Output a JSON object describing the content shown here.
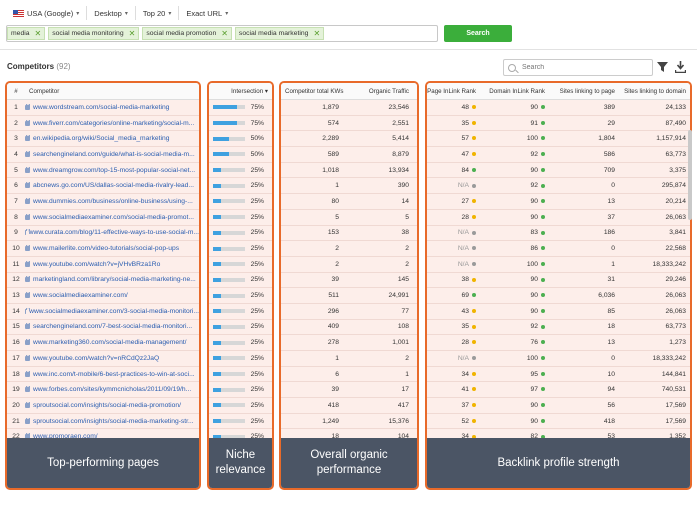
{
  "filters": {
    "country": "USA (Google)",
    "device": "Desktop",
    "top": "Top 20",
    "match": "Exact URL"
  },
  "keywords": [
    "media",
    "social media monitoring",
    "social media promotion",
    "social media marketing"
  ],
  "search_button": "Search",
  "competitors": {
    "title": "Competitors",
    "count": "(92)"
  },
  "table_search_placeholder": "Search",
  "headers": {
    "num": "#",
    "competitor": "Competitor",
    "intersection": "Intersection",
    "total_kws": "Competitor total KWs",
    "organic_traffic": "Organic Traffic",
    "page_inlink": "Page InLink Rank",
    "domain_inlink": "Domain InLink Rank",
    "sites_page": "Sites linking to page",
    "sites_domain": "Sites linking to domain"
  },
  "colors": {
    "accent": "#e86a2a",
    "green": "#3bae3b",
    "bar": "#3fa1e0",
    "dot_green": "#4caf50",
    "dot_yellow": "#f0b400",
    "dot_grey": "#9a9a9a"
  },
  "rows": [
    {
      "n": "1",
      "url": "www.wordstream.com/social-media-marketing",
      "pct": "75%",
      "fill": 0.75,
      "kws": "1,879",
      "traffic": "23,546",
      "pir": "48",
      "pird": "yellow",
      "dir": "90",
      "dird": "green",
      "slp": "389",
      "sld": "24,133"
    },
    {
      "n": "2",
      "url": "www.fiverr.com/categories/online-marketing/social-m...",
      "pct": "75%",
      "fill": 0.75,
      "kws": "574",
      "traffic": "2,551",
      "pir": "35",
      "pird": "yellow",
      "dir": "91",
      "dird": "green",
      "slp": "29",
      "sld": "87,490"
    },
    {
      "n": "3",
      "url": "en.wikipedia.org/wiki/Social_media_marketing",
      "pct": "50%",
      "fill": 0.5,
      "kws": "2,289",
      "traffic": "5,414",
      "pir": "57",
      "pird": "yellow",
      "dir": "100",
      "dird": "green",
      "slp": "1,804",
      "sld": "1,157,914"
    },
    {
      "n": "4",
      "url": "searchengineland.com/guide/what-is-social-media-m...",
      "pct": "50%",
      "fill": 0.5,
      "kws": "589",
      "traffic": "8,879",
      "pir": "47",
      "pird": "yellow",
      "dir": "92",
      "dird": "green",
      "slp": "586",
      "sld": "63,773"
    },
    {
      "n": "5",
      "url": "www.dreamgrow.com/top-15-most-popular-social-net...",
      "pct": "25%",
      "fill": 0.25,
      "kws": "1,018",
      "traffic": "13,934",
      "pir": "84",
      "pird": "green",
      "dir": "90",
      "dird": "green",
      "slp": "709",
      "sld": "3,375"
    },
    {
      "n": "6",
      "url": "abcnews.go.com/US/dallas-social-media-rivalry-lead...",
      "pct": "25%",
      "fill": 0.25,
      "kws": "1",
      "traffic": "390",
      "pir": "N/A",
      "pird": "grey",
      "dir": "92",
      "dird": "green",
      "slp": "0",
      "sld": "295,874"
    },
    {
      "n": "7",
      "url": "www.dummies.com/business/online-business/using-...",
      "pct": "25%",
      "fill": 0.25,
      "kws": "80",
      "traffic": "14",
      "pir": "27",
      "pird": "yellow",
      "dir": "90",
      "dird": "green",
      "slp": "13",
      "sld": "20,214"
    },
    {
      "n": "8",
      "url": "www.socialmediaexaminer.com/social-media-promot...",
      "pct": "25%",
      "fill": 0.25,
      "kws": "5",
      "traffic": "5",
      "pir": "28",
      "pird": "yellow",
      "dir": "90",
      "dird": "green",
      "slp": "37",
      "sld": "26,063"
    },
    {
      "n": "9",
      "url": "www.curata.com/blog/11-effective-ways-to-use-social-m...",
      "pct": "25%",
      "fill": 0.25,
      "kws": "153",
      "traffic": "38",
      "pir": "N/A",
      "pird": "grey",
      "dir": "83",
      "dird": "green",
      "slp": "186",
      "sld": "3,841"
    },
    {
      "n": "10",
      "url": "www.mailerlite.com/video-tutorials/social-pop-ups",
      "pct": "25%",
      "fill": 0.25,
      "kws": "2",
      "traffic": "2",
      "pir": "N/A",
      "pird": "grey",
      "dir": "86",
      "dird": "green",
      "slp": "0",
      "sld": "22,568"
    },
    {
      "n": "11",
      "url": "www.youtube.com/watch?v=jVHvBRza1Ro",
      "pct": "25%",
      "fill": 0.25,
      "kws": "2",
      "traffic": "2",
      "pir": "N/A",
      "pird": "grey",
      "dir": "100",
      "dird": "green",
      "slp": "1",
      "sld": "18,333,242"
    },
    {
      "n": "12",
      "url": "marketingland.com/library/social-media-marketing-ne...",
      "pct": "25%",
      "fill": 0.25,
      "kws": "39",
      "traffic": "145",
      "pir": "38",
      "pird": "yellow",
      "dir": "90",
      "dird": "green",
      "slp": "31",
      "sld": "29,246"
    },
    {
      "n": "13",
      "url": "www.socialmediaexaminer.com/",
      "pct": "25%",
      "fill": 0.25,
      "kws": "511",
      "traffic": "24,991",
      "pir": "69",
      "pird": "green",
      "dir": "90",
      "dird": "green",
      "slp": "6,036",
      "sld": "26,063"
    },
    {
      "n": "14",
      "url": "www.socialmediaexaminer.com/3-social-media-monitori...",
      "pct": "25%",
      "fill": 0.25,
      "kws": "296",
      "traffic": "77",
      "pir": "43",
      "pird": "yellow",
      "dir": "90",
      "dird": "green",
      "slp": "85",
      "sld": "26,063"
    },
    {
      "n": "15",
      "url": "searchengineland.com/7-best-social-media-monitori...",
      "pct": "25%",
      "fill": 0.25,
      "kws": "409",
      "traffic": "108",
      "pir": "35",
      "pird": "yellow",
      "dir": "92",
      "dird": "green",
      "slp": "18",
      "sld": "63,773"
    },
    {
      "n": "16",
      "url": "www.marketing360.com/social-media-management/",
      "pct": "25%",
      "fill": 0.25,
      "kws": "278",
      "traffic": "1,001",
      "pir": "28",
      "pird": "yellow",
      "dir": "76",
      "dird": "green",
      "slp": "13",
      "sld": "1,273"
    },
    {
      "n": "17",
      "url": "www.youtube.com/watch?v=nRCdQz2JaQ",
      "pct": "25%",
      "fill": 0.25,
      "kws": "1",
      "traffic": "2",
      "pir": "N/A",
      "pird": "grey",
      "dir": "100",
      "dird": "green",
      "slp": "0",
      "sld": "18,333,242"
    },
    {
      "n": "18",
      "url": "www.inc.com/t-mobile/6-best-practices-to-win-at-soci...",
      "pct": "25%",
      "fill": 0.25,
      "kws": "6",
      "traffic": "1",
      "pir": "34",
      "pird": "yellow",
      "dir": "95",
      "dird": "green",
      "slp": "10",
      "sld": "144,841"
    },
    {
      "n": "19",
      "url": "www.forbes.com/sites/kymmcnicholas/2011/09/19/h...",
      "pct": "25%",
      "fill": 0.25,
      "kws": "39",
      "traffic": "17",
      "pir": "41",
      "pird": "yellow",
      "dir": "97",
      "dird": "green",
      "slp": "94",
      "sld": "740,531"
    },
    {
      "n": "20",
      "url": "sproutsocial.com/insights/social-media-promotion/",
      "pct": "25%",
      "fill": 0.25,
      "kws": "418",
      "traffic": "417",
      "pir": "37",
      "pird": "yellow",
      "dir": "90",
      "dird": "green",
      "slp": "56",
      "sld": "17,569"
    },
    {
      "n": "21",
      "url": "sproutsocial.com/insights/social-media-marketing-str...",
      "pct": "25%",
      "fill": 0.25,
      "kws": "1,249",
      "traffic": "15,376",
      "pir": "52",
      "pird": "yellow",
      "dir": "90",
      "dird": "green",
      "slp": "418",
      "sld": "17,569"
    },
    {
      "n": "22",
      "url": "www.promoraen.com/",
      "pct": "25%",
      "fill": 0.25,
      "kws": "18",
      "traffic": "104",
      "pir": "34",
      "pird": "yellow",
      "dir": "82",
      "dird": "green",
      "slp": "53",
      "sld": "1,352"
    }
  ],
  "panels": {
    "pages": "Top-performing pages",
    "niche": "Niche relevance",
    "organic": "Overall organic performance",
    "backlink": "Backlink profile strength"
  }
}
